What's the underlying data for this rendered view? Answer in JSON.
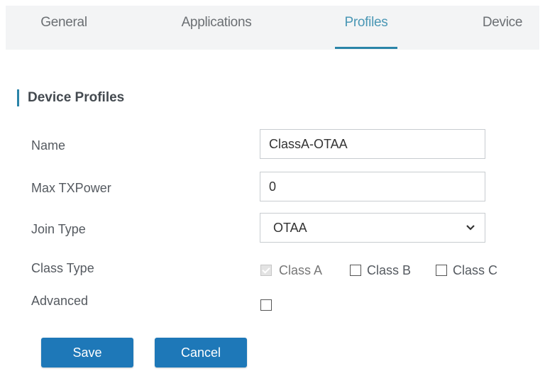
{
  "tabs": [
    {
      "label": "General",
      "active": false
    },
    {
      "label": "Applications",
      "active": false
    },
    {
      "label": "Profiles",
      "active": true
    },
    {
      "label": "Device",
      "active": false
    }
  ],
  "section": {
    "title": "Device Profiles"
  },
  "form": {
    "name": {
      "label": "Name",
      "value": "ClassA-OTAA"
    },
    "max_txpower": {
      "label": "Max TXPower",
      "value": "0"
    },
    "join_type": {
      "label": "Join Type",
      "value": "OTAA"
    },
    "class_type": {
      "label": "Class Type",
      "options": [
        {
          "label": "Class A",
          "checked": true,
          "disabled": true
        },
        {
          "label": "Class B",
          "checked": false
        },
        {
          "label": "Class C",
          "checked": false
        }
      ]
    },
    "advanced": {
      "label": "Advanced",
      "checked": false
    }
  },
  "buttons": {
    "save": "Save",
    "cancel": "Cancel"
  },
  "colors": {
    "accent": "#2a84a8",
    "button": "#1e78b8",
    "tab_bg": "#f3f4f5"
  }
}
